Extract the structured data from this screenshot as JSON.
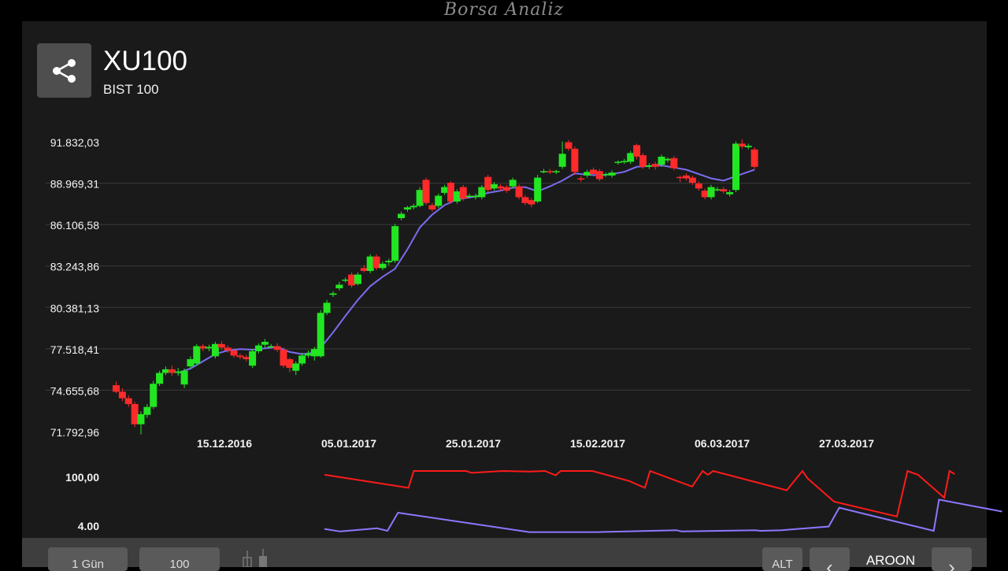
{
  "watermark": "Borsa Analiz",
  "header": {
    "symbol": "XU100",
    "name": "BIST 100"
  },
  "icons": {
    "share": "share-icon",
    "candle_style": "candlestick-icon",
    "prev": "chevron-left-icon",
    "next": "chevron-right-icon"
  },
  "colors": {
    "up": "#22e622",
    "down": "#ff2a2a",
    "ma": "#7a6cf0",
    "aroon_up": "#ff1a1a",
    "aroon_down": "#8c78ff",
    "panel": "#1a1a1a",
    "grid": "#3a3a3a"
  },
  "toolbar": {
    "period": "1 Gün",
    "count": "100",
    "alt": "ALT",
    "indicator": "AROON",
    "prev": "‹",
    "next": "›"
  },
  "chart_data": [
    {
      "type": "candlestick",
      "title": "XU100",
      "y_tick_labels": [
        "91.832,03",
        "88.969,31",
        "86.106,58",
        "83.243,86",
        "80.381,13",
        "77.518,41",
        "74.655,68",
        "71.792,96"
      ],
      "y_ticks": [
        91832.03,
        88969.31,
        86106.58,
        83243.86,
        80381.13,
        77518.41,
        74655.68,
        71792.96
      ],
      "ylim": [
        71792.96,
        91832.03
      ],
      "x_tick_labels": [
        "15.12.2016",
        "05.01.2017",
        "25.01.2017",
        "15.02.2017",
        "06.03.2017",
        "27.03.2017"
      ],
      "grid": true,
      "candles": [
        [
          75000,
          74550,
          75250,
          74450
        ],
        [
          74550,
          74100,
          74800,
          73900
        ],
        [
          74100,
          73700,
          74300,
          73500
        ],
        [
          73700,
          72300,
          73850,
          72100
        ],
        [
          72300,
          73000,
          73200,
          71600
        ],
        [
          72950,
          73500,
          73700,
          72750
        ],
        [
          73500,
          75100,
          75300,
          73350
        ],
        [
          75100,
          75850,
          76000,
          74950
        ],
        [
          75850,
          76100,
          76300,
          75700
        ],
        [
          76100,
          75850,
          76350,
          75650
        ],
        [
          75850,
          75950,
          76200,
          75650
        ],
        [
          75050,
          76000,
          76150,
          74800
        ],
        [
          76300,
          76800,
          77000,
          76150
        ],
        [
          76500,
          77700,
          77850,
          76350
        ],
        [
          77700,
          77550,
          77850,
          77350
        ],
        [
          77550,
          77650,
          77800,
          77350
        ],
        [
          77000,
          77850,
          78000,
          76850
        ],
        [
          77850,
          77600,
          78050,
          77450
        ],
        [
          77600,
          77400,
          77750,
          77250
        ],
        [
          77400,
          77050,
          77550,
          76900
        ],
        [
          77050,
          76950,
          77200,
          76800
        ],
        [
          76950,
          76800,
          77100,
          76650
        ],
        [
          76350,
          77350,
          77500,
          76200
        ],
        [
          77350,
          77750,
          77900,
          77200
        ],
        [
          77800,
          78000,
          78200,
          77600
        ],
        [
          77700,
          77700,
          77850,
          77550
        ],
        [
          77700,
          77450,
          77900,
          77300
        ],
        [
          77450,
          76350,
          77600,
          76200
        ],
        [
          76800,
          76200,
          76900,
          75900
        ],
        [
          76000,
          76500,
          76650,
          75700
        ],
        [
          76500,
          77050,
          77250,
          76350
        ],
        [
          77050,
          77200,
          77400,
          76900
        ],
        [
          77000,
          77500,
          77650,
          76700
        ],
        [
          77000,
          80000,
          80200,
          76900
        ],
        [
          80000,
          80700,
          80900,
          79850
        ],
        [
          81250,
          81350,
          81500,
          81100
        ],
        [
          81700,
          81950,
          82150,
          81550
        ],
        [
          82250,
          82300,
          82450,
          82100
        ],
        [
          82650,
          81900,
          82800,
          81750
        ],
        [
          82000,
          82650,
          82800,
          81900
        ],
        [
          83100,
          82900,
          83300,
          82800
        ],
        [
          82900,
          83900,
          84050,
          82750
        ],
        [
          83900,
          83100,
          84050,
          82950
        ],
        [
          83100,
          83400,
          83550,
          82950
        ],
        [
          83500,
          83600,
          83750,
          83300
        ],
        [
          83600,
          86000,
          86150,
          83450
        ],
        [
          86550,
          86850,
          87000,
          86400
        ],
        [
          87150,
          87300,
          87400,
          87000
        ],
        [
          87300,
          87400,
          87550,
          87150
        ],
        [
          87400,
          88500,
          88700,
          87300
        ],
        [
          89200,
          87600,
          89350,
          87450
        ],
        [
          87450,
          87150,
          87600,
          87000
        ],
        [
          87400,
          88100,
          88250,
          87250
        ],
        [
          88300,
          88700,
          88850,
          88150
        ],
        [
          89000,
          87700,
          89100,
          87550
        ],
        [
          87700,
          88400,
          88550,
          87550
        ],
        [
          88700,
          87900,
          88850,
          87750
        ],
        [
          88100,
          88100,
          88250,
          87950
        ],
        [
          88000,
          88100,
          88250,
          87850
        ],
        [
          88000,
          88700,
          88850,
          87850
        ],
        [
          89400,
          88500,
          89550,
          88350
        ],
        [
          88600,
          88900,
          89050,
          88450
        ],
        [
          88750,
          88600,
          88900,
          88450
        ],
        [
          88700,
          88450,
          88850,
          88300
        ],
        [
          88750,
          89200,
          89350,
          88600
        ],
        [
          88750,
          88000,
          88900,
          87850
        ],
        [
          88000,
          87600,
          88150,
          87450
        ],
        [
          87800,
          87500,
          87950,
          87300
        ],
        [
          87700,
          89350,
          89550,
          87600
        ],
        [
          89800,
          89800,
          89950,
          89650
        ],
        [
          89800,
          89750,
          89950,
          89600
        ],
        [
          89750,
          89800,
          89900,
          89600
        ],
        [
          90100,
          91000,
          91850,
          89950
        ],
        [
          91800,
          91350,
          91950,
          91200
        ],
        [
          91350,
          89750,
          91500,
          89550
        ],
        [
          89300,
          89250,
          89450,
          89050
        ],
        [
          89500,
          89750,
          89900,
          89350
        ],
        [
          89900,
          89600,
          90050,
          89450
        ],
        [
          89800,
          89250,
          89950,
          89100
        ],
        [
          89550,
          89600,
          89700,
          89400
        ],
        [
          89500,
          89700,
          89850,
          89350
        ],
        [
          90400,
          90450,
          90550,
          90250
        ],
        [
          90450,
          90500,
          90650,
          90300
        ],
        [
          90450,
          91050,
          91200,
          90300
        ],
        [
          91600,
          90800,
          91700,
          90600
        ],
        [
          90900,
          90100,
          91050,
          89950
        ],
        [
          90100,
          90200,
          90350,
          89950
        ],
        [
          90300,
          90100,
          90450,
          89900
        ],
        [
          90250,
          90800,
          90950,
          90100
        ],
        [
          90550,
          90650,
          90750,
          90400
        ],
        [
          90700,
          90000,
          90850,
          89850
        ],
        [
          89400,
          89350,
          89500,
          89050
        ],
        [
          89500,
          89300,
          89650,
          89150
        ],
        [
          89350,
          89000,
          89500,
          88850
        ],
        [
          88950,
          88600,
          89100,
          88450
        ],
        [
          88450,
          88000,
          88600,
          87850
        ],
        [
          88000,
          88700,
          88850,
          87850
        ],
        [
          88550,
          88550,
          88700,
          88400
        ],
        [
          88550,
          88400,
          88700,
          88250
        ],
        [
          88200,
          88350,
          88500,
          88050
        ],
        [
          88500,
          91700,
          91850,
          88350
        ],
        [
          91700,
          91500,
          92000,
          91350
        ],
        [
          91450,
          91550,
          91700,
          91300
        ],
        [
          91300,
          90100,
          91450,
          89950
        ]
      ],
      "ma": [
        [
          10,
          75850
        ],
        [
          12,
          76150
        ],
        [
          14,
          76650
        ],
        [
          16,
          77150
        ],
        [
          18,
          77400
        ],
        [
          20,
          77500
        ],
        [
          22,
          77450
        ],
        [
          24,
          77550
        ],
        [
          26,
          77650
        ],
        [
          28,
          77300
        ],
        [
          30,
          77150
        ],
        [
          32,
          77250
        ],
        [
          33,
          77600
        ],
        [
          35,
          78650
        ],
        [
          37,
          79800
        ],
        [
          39,
          80900
        ],
        [
          41,
          81850
        ],
        [
          43,
          82500
        ],
        [
          45,
          83050
        ],
        [
          47,
          84400
        ],
        [
          49,
          85900
        ],
        [
          51,
          86800
        ],
        [
          53,
          87450
        ],
        [
          55,
          87850
        ],
        [
          58,
          88050
        ],
        [
          60,
          88300
        ],
        [
          62,
          88450
        ],
        [
          64,
          88650
        ],
        [
          66,
          88700
        ],
        [
          68,
          88400
        ],
        [
          70,
          88750
        ],
        [
          72,
          89150
        ],
        [
          74,
          89650
        ],
        [
          76,
          89550
        ],
        [
          78,
          89500
        ],
        [
          80,
          89600
        ],
        [
          82,
          89750
        ],
        [
          84,
          90100
        ],
        [
          86,
          90150
        ],
        [
          88,
          90200
        ],
        [
          90,
          90050
        ],
        [
          92,
          89900
        ],
        [
          94,
          89600
        ],
        [
          96,
          89300
        ],
        [
          98,
          89150
        ],
        [
          100,
          89450
        ],
        [
          102,
          89750
        ],
        [
          103,
          89900
        ]
      ]
    },
    {
      "type": "line",
      "title": "AROON",
      "y_tick_labels": [
        "100,00",
        "4.00"
      ],
      "ylim": [
        4,
        100
      ],
      "series": [
        {
          "color": "#ff1a1a",
          "points": [
            [
              34,
              94
            ],
            [
              50,
              73
            ],
            [
              51,
              100
            ],
            [
              61,
              100
            ],
            [
              62,
              97
            ],
            [
              68,
              100
            ],
            [
              73,
              99
            ],
            [
              76,
              100
            ],
            [
              78,
              93
            ],
            [
              79,
              100
            ],
            [
              85,
              100
            ],
            [
              92,
              84
            ],
            [
              95,
              73
            ],
            [
              96,
              100
            ],
            [
              104,
              75
            ],
            [
              106,
              100
            ],
            [
              107,
              94
            ],
            [
              108,
              100
            ],
            [
              122,
              69
            ],
            [
              125,
              100
            ],
            [
              126,
              88
            ],
            [
              131,
              51
            ],
            [
              143,
              27
            ],
            [
              145,
              100
            ],
            [
              147,
              94
            ],
            [
              152,
              57
            ],
            [
              153,
              100
            ],
            [
              154,
              95
            ]
          ]
        },
        {
          "color": "#8c78ff",
          "points": [
            [
              34,
              7
            ],
            [
              37,
              3
            ],
            [
              44,
              8
            ],
            [
              46,
              4
            ],
            [
              48,
              33
            ],
            [
              73,
              2
            ],
            [
              86,
              2
            ],
            [
              101,
              5
            ],
            [
              102,
              3
            ],
            [
              116,
              5
            ],
            [
              117,
              4
            ],
            [
              121,
              5
            ],
            [
              130,
              11
            ],
            [
              132,
              41
            ],
            [
              150,
              4
            ],
            [
              151,
              54
            ],
            [
              163,
              35
            ]
          ]
        }
      ]
    }
  ]
}
